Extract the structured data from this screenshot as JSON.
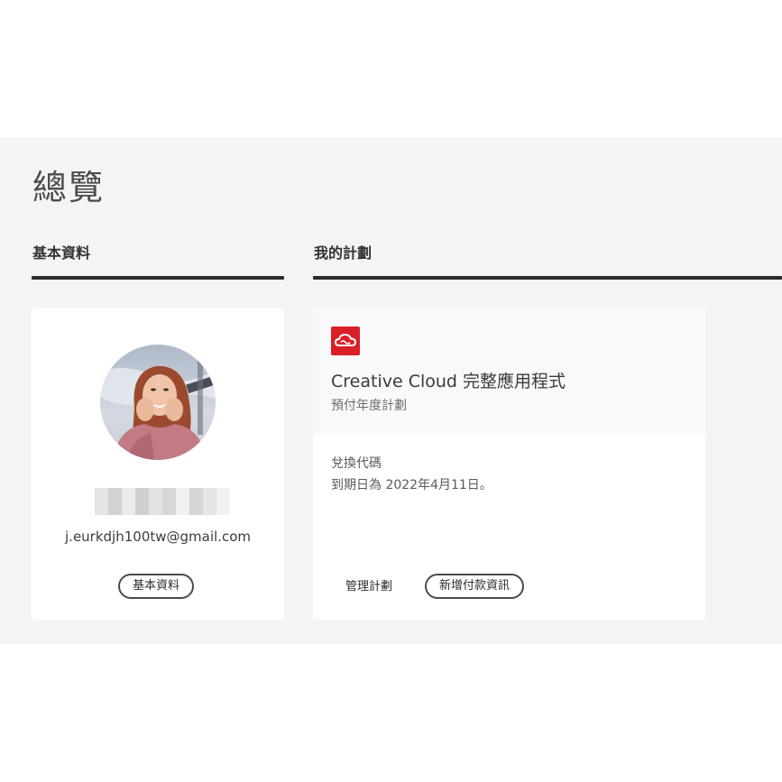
{
  "page": {
    "title": "總覽"
  },
  "sections": {
    "profile_heading": "基本資料",
    "plans_heading": "我的計劃"
  },
  "profile": {
    "email": "j.eurkdjh100tw@gmail.com",
    "profile_button": "基本資料"
  },
  "plan": {
    "name": "Creative Cloud 完整應用程式",
    "type": "預付年度計劃",
    "line1": "兌換代碼",
    "line2": "到期日為 2022年4月11日。",
    "manage_button": "管理計劃",
    "add_payment_button": "新增付款資訊",
    "logo_icon": "creative-cloud-icon",
    "brand_color": "#da1f26"
  }
}
